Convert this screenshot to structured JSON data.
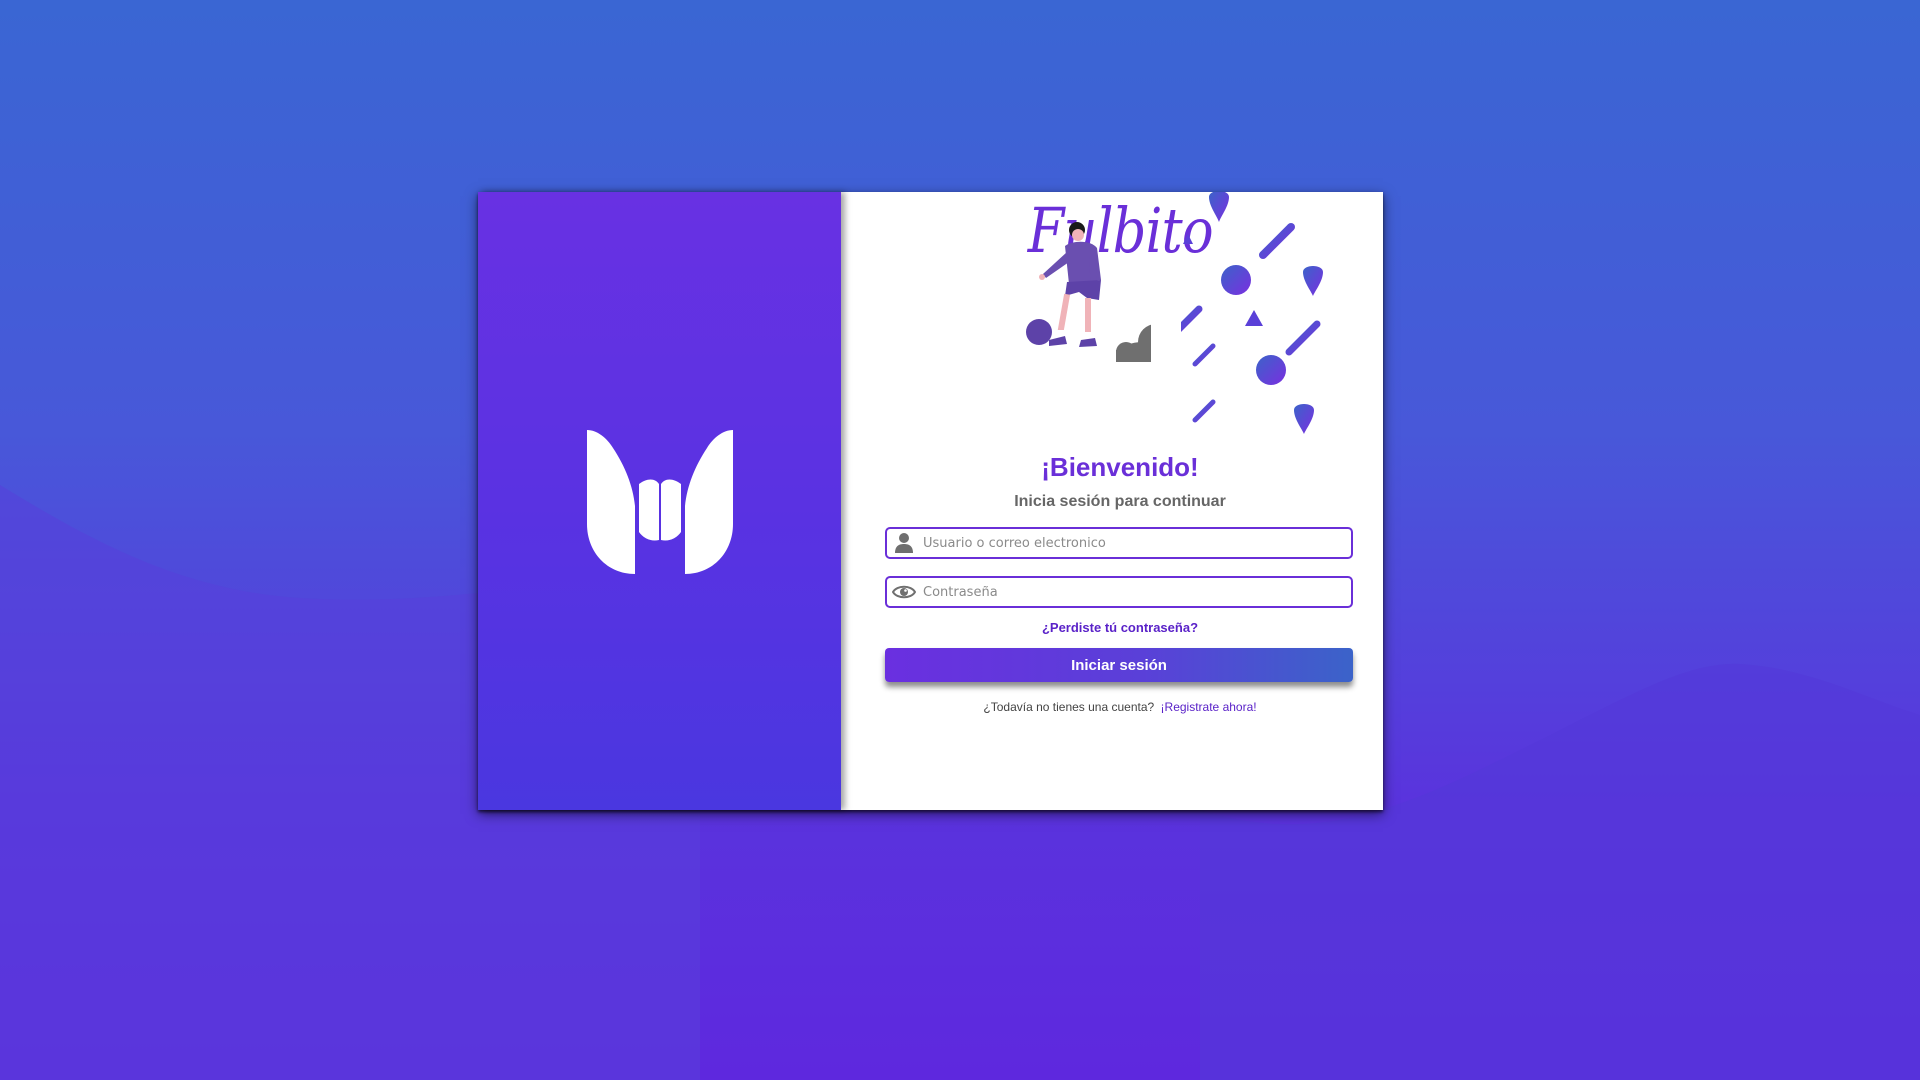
{
  "brand": {
    "name": "Fulbito"
  },
  "login": {
    "welcome": "¡Bienvenido!",
    "subtitle": "Inicia sesión para continuar",
    "username_placeholder": "Usuario o correo electronico",
    "password_placeholder": "Contraseña",
    "forgot_password": "¿Perdiste tú contraseña?",
    "submit_label": "Iniciar sesión",
    "no_account_text": "¿Todavía no tienes una cuenta?",
    "signup_link": "¡Registrate ahora!"
  },
  "icons": {
    "logo": "brand-logo-icon",
    "username": "user-icon",
    "password": "eye-icon"
  },
  "colors": {
    "accent": "#6a2fd8",
    "link": "#5a22c8",
    "panel": "#5a32e2",
    "background_top": "#3a66d3",
    "background_bottom": "#5e28de"
  }
}
